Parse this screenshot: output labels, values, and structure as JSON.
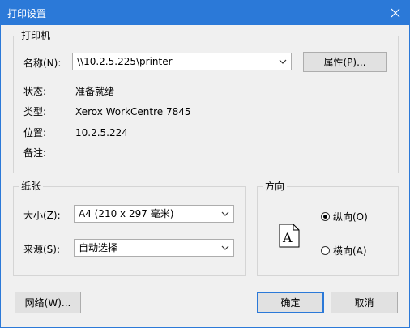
{
  "window": {
    "title": "打印设置"
  },
  "printer_group": {
    "label": "打印机",
    "name_label": "名称(N):",
    "name_value": "\\\\10.2.5.225\\printer",
    "properties_button": "属性(P)...",
    "status_label": "状态:",
    "status_value": "准备就绪",
    "type_label": "类型:",
    "type_value": "Xerox WorkCentre 7845",
    "location_label": "位置:",
    "location_value": "10.2.5.224",
    "comment_label": "备注:"
  },
  "paper_group": {
    "label": "纸张",
    "size_label": "大小(Z):",
    "size_value": "A4 (210 x 297 毫米)",
    "source_label": "来源(S):",
    "source_value": "自动选择"
  },
  "orientation_group": {
    "label": "方向",
    "portrait_label": "纵向(O)",
    "landscape_label": "横向(A)",
    "selected": "portrait",
    "page_letter": "A"
  },
  "buttons": {
    "network": "网络(W)...",
    "ok": "确定",
    "cancel": "取消"
  },
  "colors": {
    "titlebar": "#2b79d8"
  }
}
